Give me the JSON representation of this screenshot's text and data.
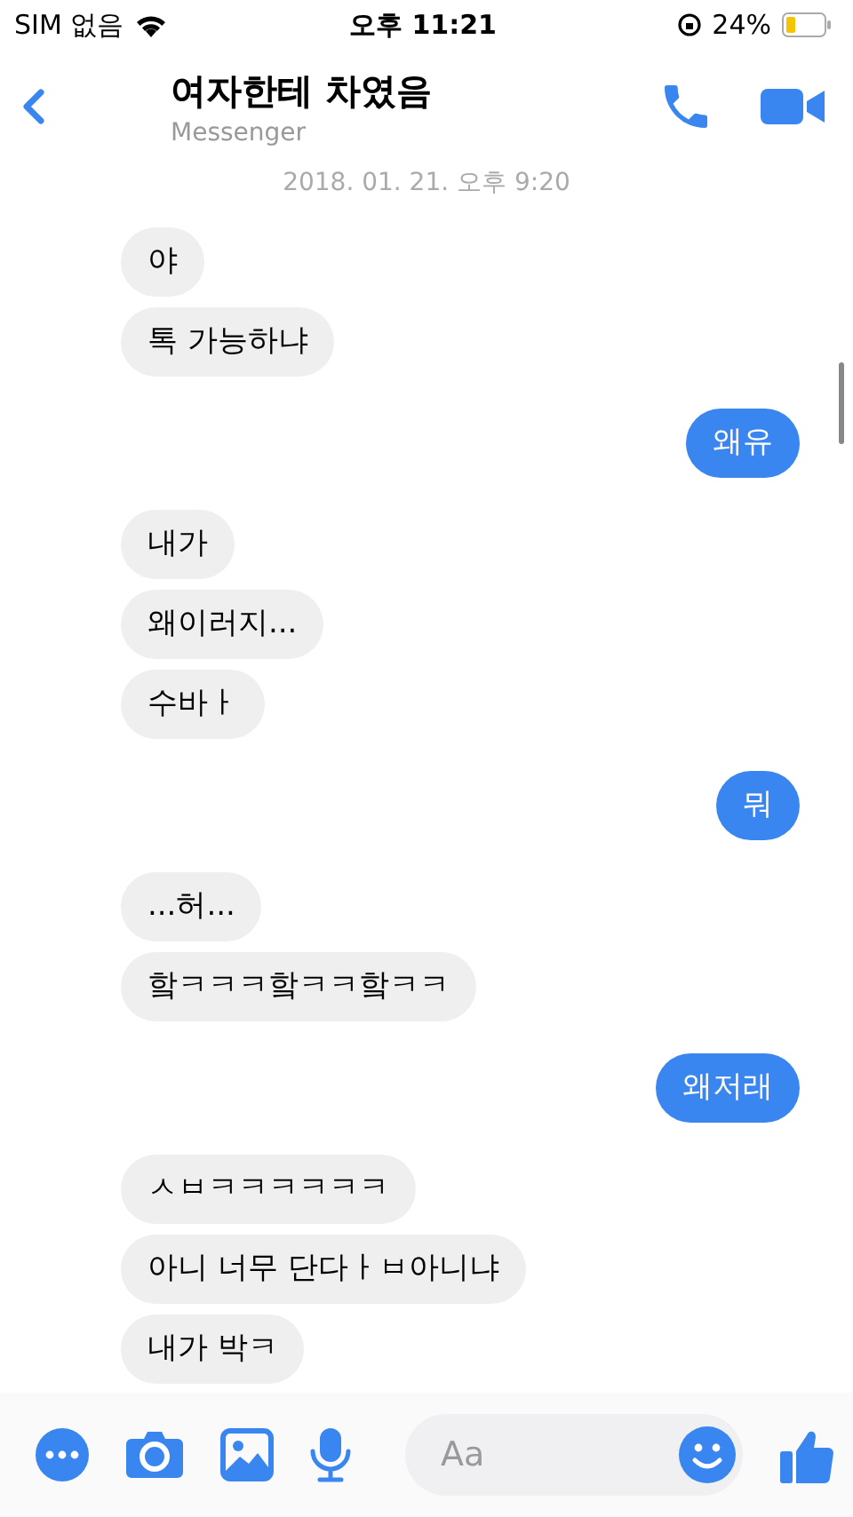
{
  "status_bar": {
    "carrier": "SIM 없음",
    "time": "오후 11:21",
    "battery": "24%"
  },
  "header": {
    "title": "여자한테 차였음",
    "subtitle": "Messenger"
  },
  "timestamp": "2018. 01. 21. 오후 9:20",
  "messages": [
    {
      "outgoing": false,
      "text": "야"
    },
    {
      "outgoing": false,
      "text": "톡 가능하냐"
    },
    {
      "outgoing": true,
      "text": "왜유"
    },
    {
      "outgoing": false,
      "text": "내가"
    },
    {
      "outgoing": false,
      "text": "왜이러지..."
    },
    {
      "outgoing": false,
      "text": "수바ㅏ"
    },
    {
      "outgoing": true,
      "text": "뭐"
    },
    {
      "outgoing": false,
      "text": "...허..."
    },
    {
      "outgoing": false,
      "text": "핰ㅋㅋㅋ핰ㅋㅋ핰ㅋㅋ"
    },
    {
      "outgoing": true,
      "text": "왜저래"
    },
    {
      "outgoing": false,
      "text": "ㅅㅂㅋㅋㅋㅋㅋㅋ"
    },
    {
      "outgoing": false,
      "text": "아니 너무 단다ㅏㅂ아니냐"
    },
    {
      "outgoing": false,
      "text": "내가 박ㅋ"
    }
  ],
  "composer": {
    "placeholder": "Aa"
  }
}
